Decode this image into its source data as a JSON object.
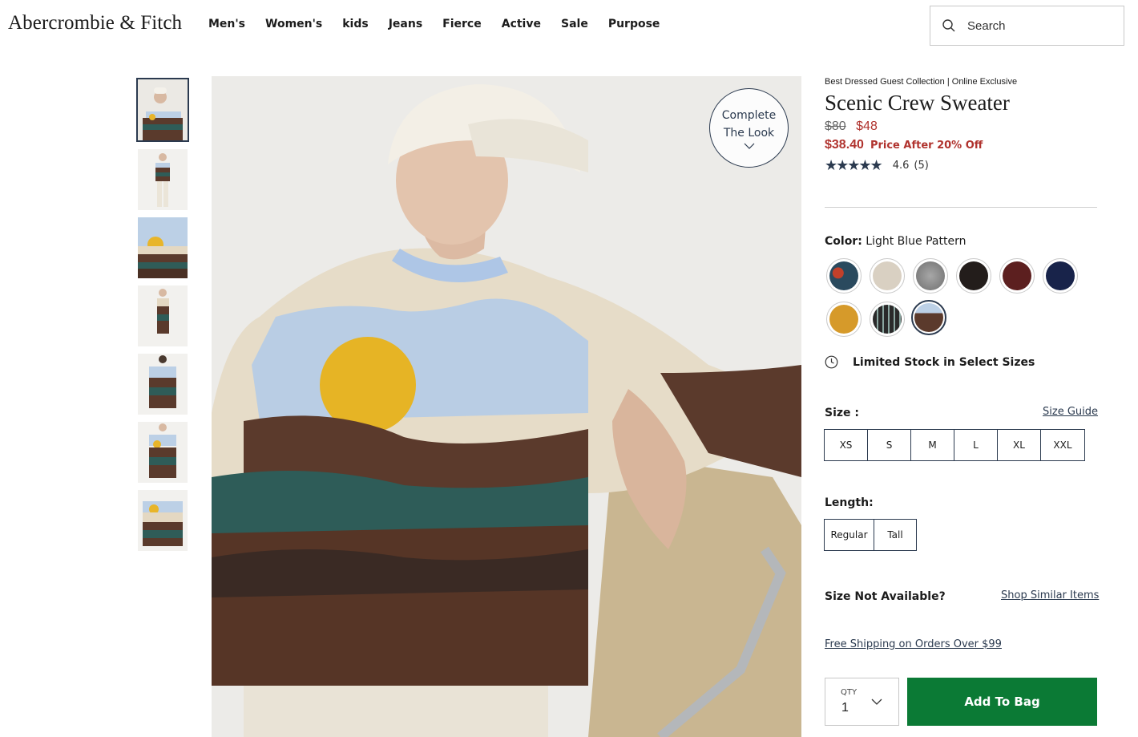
{
  "brand": {
    "logo": "Abercrombie & Fitch"
  },
  "nav": [
    "Men's",
    "Women's",
    "kids",
    "Jeans",
    "Fierce",
    "Active",
    "Sale",
    "Purpose"
  ],
  "search": {
    "placeholder": "Search",
    "icon": "search-icon"
  },
  "gallery": {
    "thumbnail_count": 7,
    "selected_index": 0,
    "complete_look": {
      "line1": "Complete",
      "line2": "The Look",
      "icon": "chevron-down-icon"
    }
  },
  "product": {
    "eyebrow": "Best Dressed Guest Collection | Online Exclusive",
    "title": "Scenic Crew Sweater",
    "price_original": "$80",
    "price_sale": "$48",
    "promo_price": "$38.40",
    "promo_text": "Price After 20% Off",
    "rating_stars": "★★★★★",
    "rating": 4.6,
    "rating_value": "4.6",
    "review_count": "(5)",
    "color_label": "Color:",
    "color_value": "Light Blue Pattern",
    "swatches": [
      {
        "name": "teal-floral",
        "color": "#2a4a5e"
      },
      {
        "name": "cream",
        "color": "#d9d0c2"
      },
      {
        "name": "heather-grey",
        "color": "#8c8c8c"
      },
      {
        "name": "black",
        "color": "#231d1b"
      },
      {
        "name": "burgundy",
        "color": "#5c1f1f"
      },
      {
        "name": "navy",
        "color": "#18234a"
      },
      {
        "name": "mustard",
        "color": "#d69a2a"
      },
      {
        "name": "black-fairisle",
        "color": "#2a2a2a"
      },
      {
        "name": "light-blue-pattern",
        "color": "#5b3a2c"
      }
    ],
    "selected_swatch": 8,
    "stock_text": "Limited Stock in Select Sizes",
    "size_label": "Size :",
    "size_guide": "Size Guide",
    "sizes": [
      "XS",
      "S",
      "M",
      "L",
      "XL",
      "XXL"
    ],
    "length_label": "Length:",
    "lengths": [
      "Regular",
      "Tall"
    ],
    "size_not_available": "Size Not Available?",
    "shop_similar": "Shop Similar Items",
    "free_shipping": "Free Shipping on Orders Over $99",
    "qty_label": "QTY",
    "qty_value": "1",
    "add_to_bag": "Add To Bag"
  },
  "colors": {
    "accent": "#2b3a4f",
    "sale": "#b0332e",
    "cta": "#0b7a35"
  }
}
